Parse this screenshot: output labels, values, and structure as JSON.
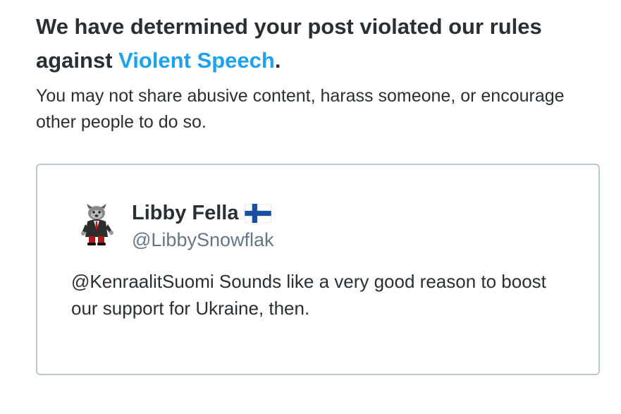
{
  "notice": {
    "headline_prefix": "We have determined your post violated our rules against ",
    "rule_name": "Violent Speech",
    "headline_suffix": ".",
    "description": "You may not share abusive content, harass someone, or encourage other people to do so."
  },
  "tweet": {
    "display_name": "Libby Fella",
    "flag_emoji": "🇫🇮",
    "handle": "@LibbySnowflak",
    "text": "@KenraalitSuomi Sounds like a very good reason to boost our support for Ukraine, then."
  },
  "colors": {
    "text": "#292f33",
    "link": "#1da1f2",
    "muted": "#657786",
    "card_border": "#bcc7d0"
  }
}
